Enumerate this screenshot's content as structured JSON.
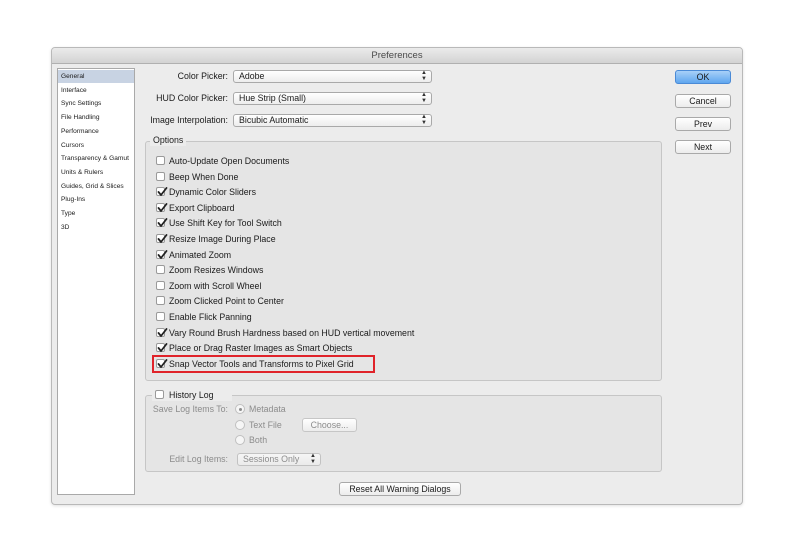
{
  "window": {
    "title": "Preferences"
  },
  "sidebar": {
    "items": [
      {
        "label": "General",
        "selected": true
      },
      {
        "label": "Interface"
      },
      {
        "label": "Sync Settings"
      },
      {
        "label": "File Handling"
      },
      {
        "label": "Performance"
      },
      {
        "label": "Cursors"
      },
      {
        "label": "Transparency & Gamut"
      },
      {
        "label": "Units & Rulers"
      },
      {
        "label": "Guides, Grid & Slices"
      },
      {
        "label": "Plug-Ins"
      },
      {
        "label": "Type"
      },
      {
        "label": "3D"
      }
    ]
  },
  "pickers": {
    "color_picker": {
      "label": "Color Picker:",
      "value": "Adobe"
    },
    "hud_color_picker": {
      "label": "HUD Color Picker:",
      "value": "Hue Strip (Small)"
    },
    "image_interpolation": {
      "label": "Image Interpolation:",
      "value": "Bicubic Automatic"
    }
  },
  "options": {
    "legend": "Options",
    "items": [
      {
        "label": "Auto-Update Open Documents",
        "checked": false
      },
      {
        "label": "Beep When Done",
        "checked": false
      },
      {
        "label": "Dynamic Color Sliders",
        "checked": true
      },
      {
        "label": "Export Clipboard",
        "checked": true
      },
      {
        "label": "Use Shift Key for Tool Switch",
        "checked": true
      },
      {
        "label": "Resize Image During Place",
        "checked": true
      },
      {
        "label": "Animated Zoom",
        "checked": true
      },
      {
        "label": "Zoom Resizes Windows",
        "checked": false
      },
      {
        "label": "Zoom with Scroll Wheel",
        "checked": false
      },
      {
        "label": "Zoom Clicked Point to Center",
        "checked": false
      },
      {
        "label": "Enable Flick Panning",
        "checked": false
      },
      {
        "label": "Vary Round Brush Hardness based on HUD vertical movement",
        "checked": true
      },
      {
        "label": "Place or Drag Raster Images as Smart Objects",
        "checked": true
      },
      {
        "label": "Snap Vector Tools and Transforms to Pixel Grid",
        "checked": true,
        "highlighted": true
      }
    ]
  },
  "history": {
    "legend": "History Log",
    "checked": false,
    "save_to_label": "Save Log Items To:",
    "radios": [
      {
        "label": "Metadata",
        "selected": true
      },
      {
        "label": "Text File",
        "selected": false
      },
      {
        "label": "Both",
        "selected": false
      }
    ],
    "choose_label": "Choose...",
    "edit_label": "Edit Log Items:",
    "edit_value": "Sessions Only"
  },
  "buttons": {
    "ok": "OK",
    "cancel": "Cancel",
    "prev": "Prev",
    "next": "Next",
    "reset": "Reset All Warning Dialogs"
  },
  "colors": {
    "highlight": "#e0232a",
    "accent": "#5fa6ef",
    "selection": "#c8d3e3"
  }
}
